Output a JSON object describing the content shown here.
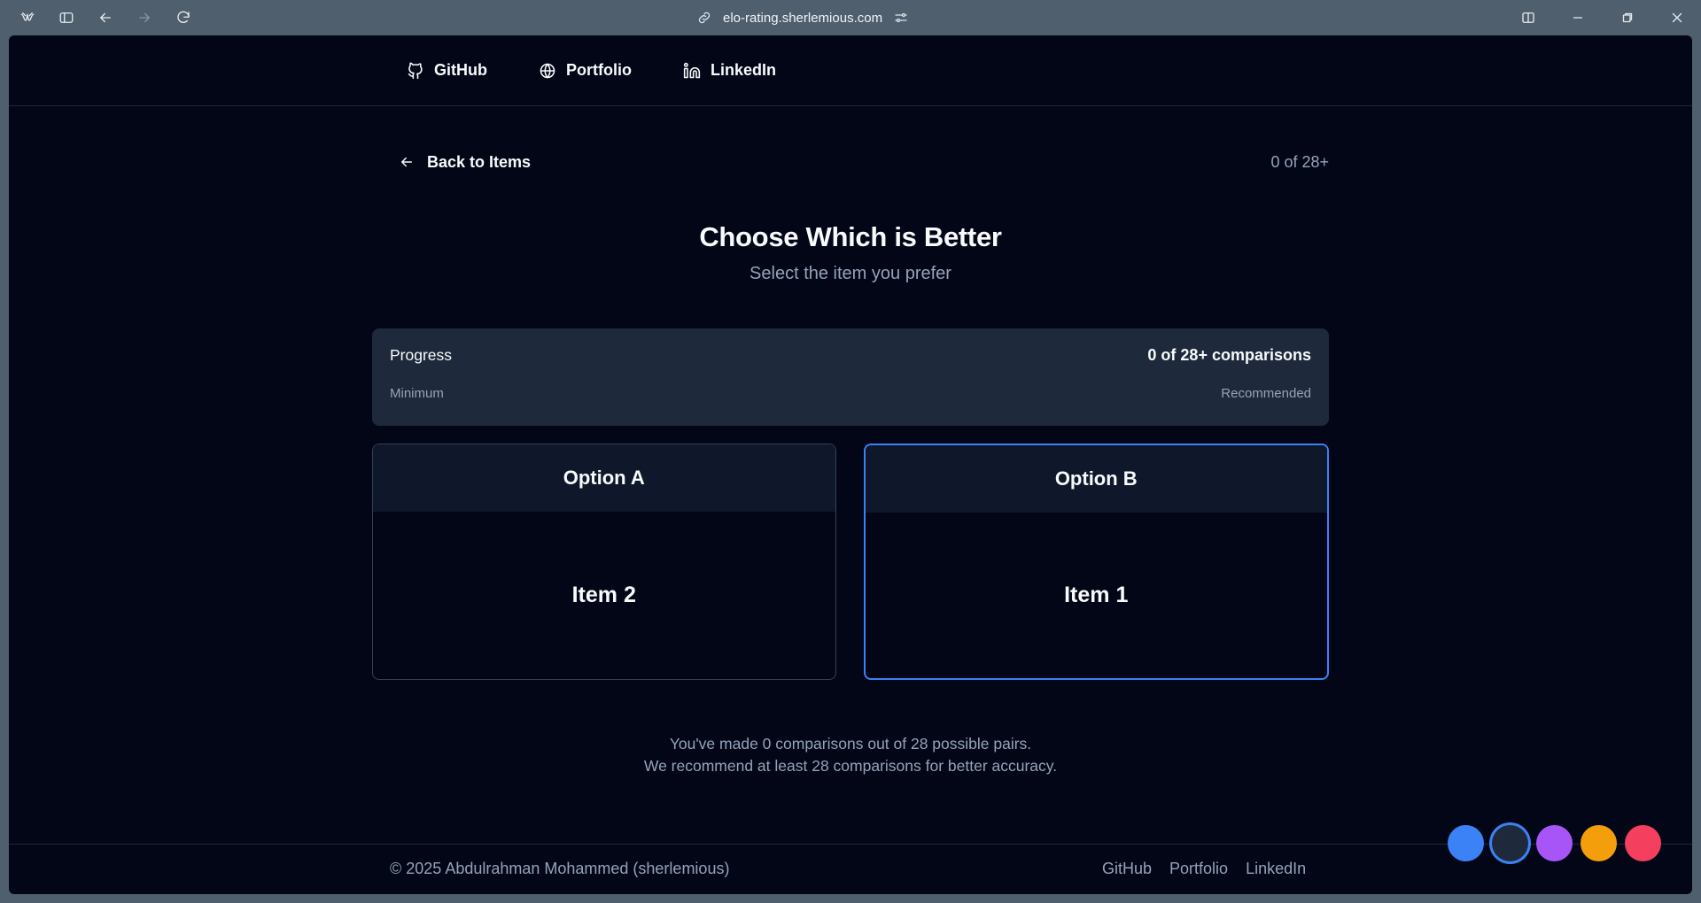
{
  "browser": {
    "url": "elo-rating.sherlemious.com",
    "icons": [
      "app-logo-icon",
      "sidebar-toggle-icon",
      "back-arrow-icon",
      "forward-arrow-icon",
      "reload-icon",
      "link-icon",
      "site-settings-icon",
      "split-view-icon",
      "minimize-icon",
      "restore-icon",
      "close-icon"
    ]
  },
  "nav": {
    "github": "GitHub",
    "portfolio": "Portfolio",
    "linkedin": "LinkedIn"
  },
  "page": {
    "back_label": "Back to Items",
    "counter": "0 of 28+",
    "title": "Choose Which is Better",
    "subtitle": "Select the item you prefer"
  },
  "progress": {
    "label": "Progress",
    "value_text": "0 of 28+ comparisons",
    "min_label": "Minimum",
    "rec_label": "Recommended",
    "fraction": 0
  },
  "options": [
    {
      "header": "Option A",
      "item": "Item 2",
      "selected": false
    },
    {
      "header": "Option B",
      "item": "Item 1",
      "selected": true
    }
  ],
  "note": {
    "line1": "You've made 0 comparisons out of 28 possible pairs.",
    "line2": "We recommend at least 28 comparisons for better accuracy."
  },
  "footer": {
    "copyright": "© 2025 Abdulrahman Mohammed (sherlemious)",
    "github": "GitHub",
    "portfolio": "Portfolio",
    "linkedin": "LinkedIn"
  },
  "theme_swatches": [
    {
      "name": "blue",
      "color": "#3b82f6",
      "active": false
    },
    {
      "name": "slate",
      "color": "#1e293b",
      "active": true
    },
    {
      "name": "purple",
      "color": "#a855f7",
      "active": false
    },
    {
      "name": "amber",
      "color": "#f59e0b",
      "active": false
    },
    {
      "name": "rose",
      "color": "#f43f5e",
      "active": false
    }
  ]
}
